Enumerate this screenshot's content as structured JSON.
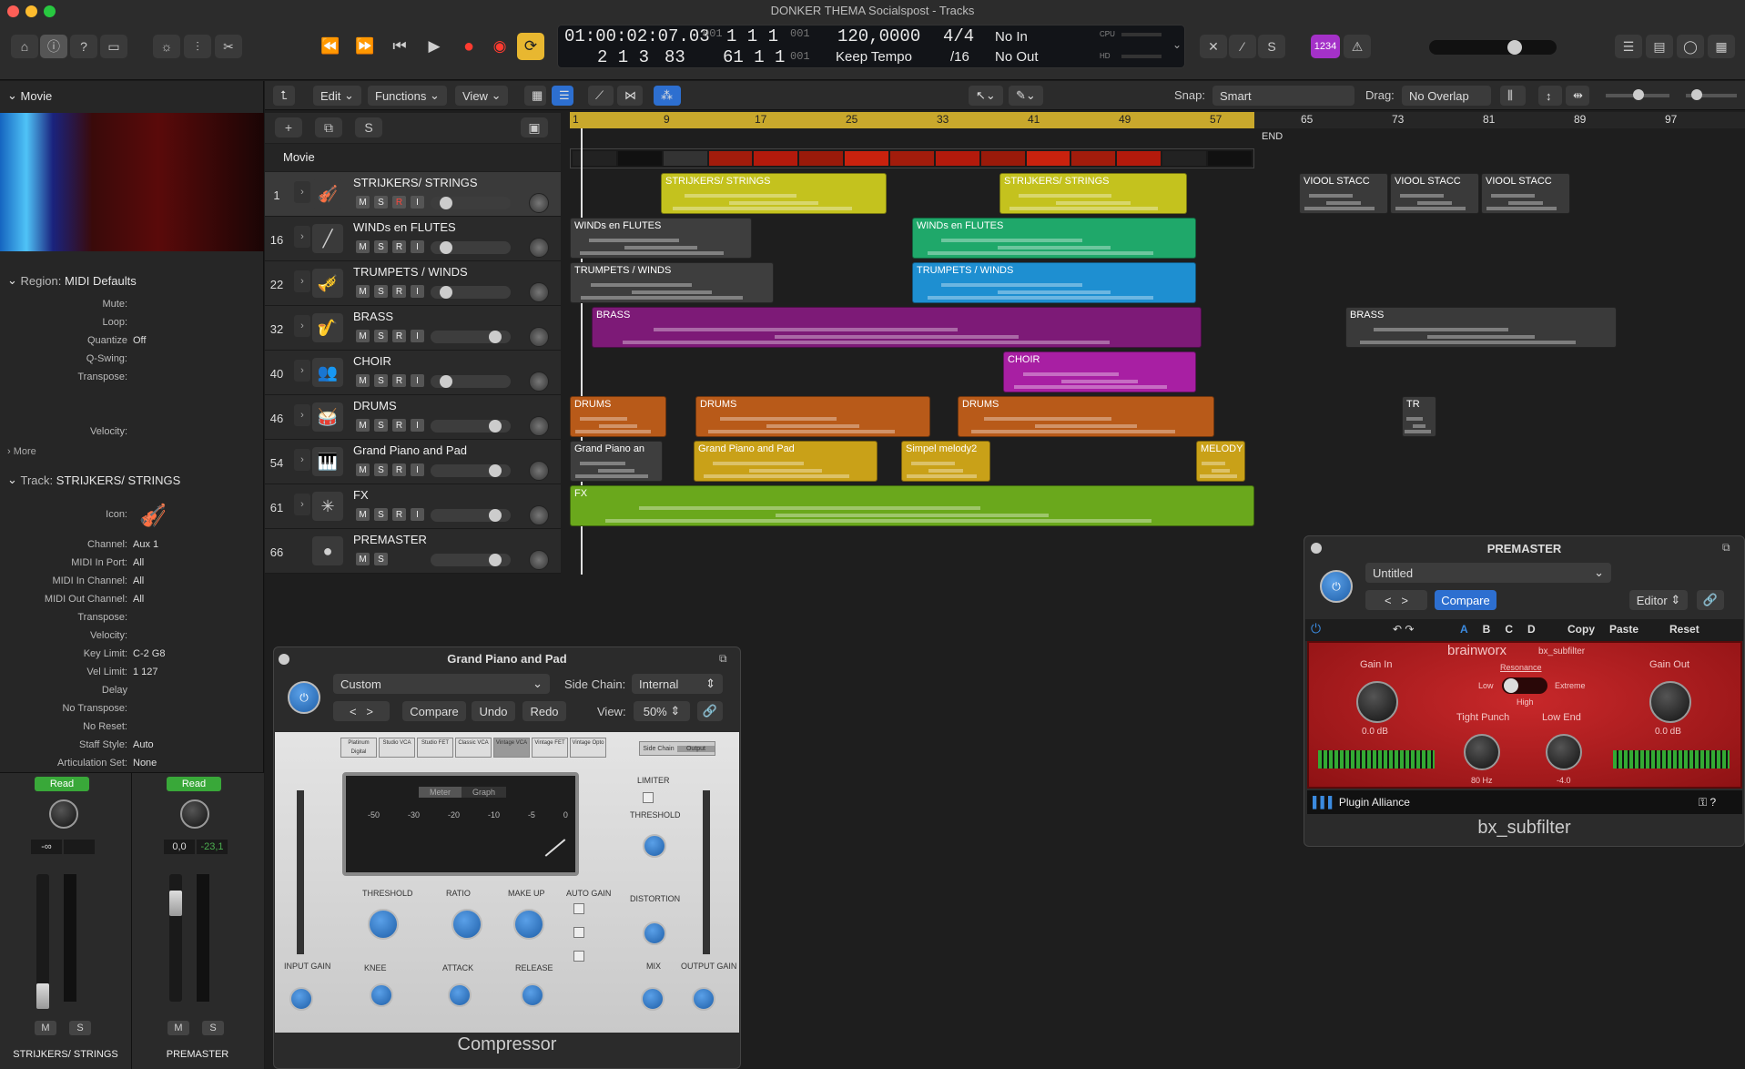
{
  "window": {
    "title": "DONKER THEMA Socialspost - Tracks"
  },
  "lcd": {
    "time": "01:00:02:07.03",
    "bars_top": "1  1  1",
    "bars_top_sub": "001",
    "bars_top_sub2": "001",
    "tempo": "120,0000",
    "signature": "4/4",
    "midi_in": "No In",
    "bars_bottom": "2  1  3",
    "bars_bottom_sub": "83",
    "pos2": "61  1  1",
    "pos2_sub": "001",
    "tempo_mode": "Keep Tempo",
    "division": "/16",
    "midi_out": "No Out",
    "cpu": "CPU",
    "hd": "HD"
  },
  "toolbar": {
    "count_in": "1234"
  },
  "tracks_menu": {
    "edit": "Edit",
    "functions": "Functions",
    "view": "View",
    "snap_label": "Snap:",
    "snap_value": "Smart",
    "drag_label": "Drag:",
    "drag_value": "No Overlap"
  },
  "inspector": {
    "movie_header": "Movie",
    "region_prefix": "Region:",
    "region_name": "MIDI Defaults",
    "region_rows": [
      {
        "k": "Mute:",
        "v": ""
      },
      {
        "k": "Loop:",
        "v": ""
      },
      {
        "k": "Quantize",
        "v": "Off"
      },
      {
        "k": "Q-Swing:",
        "v": ""
      },
      {
        "k": "Transpose:",
        "v": ""
      },
      {
        "k": "Velocity:",
        "v": ""
      }
    ],
    "more": "More",
    "track_prefix": "Track:",
    "track_name": "STRIJKERS/ STRINGS",
    "track_rows": [
      {
        "k": "Icon:",
        "v": ""
      },
      {
        "k": "Channel:",
        "v": "Aux 1"
      },
      {
        "k": "MIDI In Port:",
        "v": "All"
      },
      {
        "k": "MIDI In Channel:",
        "v": "All"
      },
      {
        "k": "MIDI Out Channel:",
        "v": "All"
      },
      {
        "k": "Transpose:",
        "v": ""
      },
      {
        "k": "Velocity:",
        "v": ""
      },
      {
        "k": "Key Limit:",
        "v": "C-2  G8"
      },
      {
        "k": "Vel Limit:",
        "v": "1  127"
      },
      {
        "k": "Delay",
        "v": ""
      },
      {
        "k": "No Transpose:",
        "v": ""
      },
      {
        "k": "No Reset:",
        "v": ""
      },
      {
        "k": "Staff Style:",
        "v": "Auto"
      },
      {
        "k": "Articulation Set:",
        "v": "None"
      }
    ],
    "strip1": {
      "read": "Read",
      "vol": "-∞",
      "name": "STRIJKERS/ STRINGS",
      "m": "M",
      "s": "S"
    },
    "strip2": {
      "read": "Read",
      "vol": "0,0",
      "peak": "-23,1",
      "name": "PREMASTER",
      "m": "M",
      "s": "S"
    }
  },
  "movie_track": "Movie",
  "tracks": [
    {
      "num": "1",
      "name": "STRIJKERS/ STRINGS",
      "icon": "violin-icon",
      "r_red": true
    },
    {
      "num": "16",
      "name": "WINDs en FLUTES",
      "icon": "flute-icon"
    },
    {
      "num": "22",
      "name": "TRUMPETS / WINDS",
      "icon": "trumpet-icon"
    },
    {
      "num": "32",
      "name": "BRASS",
      "icon": "horn-icon"
    },
    {
      "num": "40",
      "name": "CHOIR",
      "icon": "choir-icon"
    },
    {
      "num": "46",
      "name": "DRUMS",
      "icon": "drum-icon"
    },
    {
      "num": "54",
      "name": "Grand Piano and Pad",
      "icon": "piano-icon"
    },
    {
      "num": "61",
      "name": "FX",
      "icon": "fx-icon"
    },
    {
      "num": "66",
      "name": "PREMASTER",
      "icon": "master-icon"
    }
  ],
  "ruler": [
    "1",
    "9",
    "17",
    "25",
    "33",
    "41",
    "49",
    "57",
    "65",
    "73",
    "81",
    "89",
    "97"
  ],
  "end_label": "END",
  "regions": [
    {
      "track": 0,
      "label": "STRIJKERS/ STRINGS"
    },
    {
      "track": 0,
      "label": "STRIJKERS/ STRINGS"
    },
    {
      "track": 0,
      "label": "VIOOL STACC"
    },
    {
      "track": 0,
      "label": "VIOOL STACC"
    },
    {
      "track": 0,
      "label": "VIOOL STACC"
    },
    {
      "track": 1,
      "label": "WINDs en FLUTES"
    },
    {
      "track": 1,
      "label": "WINDs en FLUTES"
    },
    {
      "track": 2,
      "label": "TRUMPETS / WINDS"
    },
    {
      "track": 2,
      "label": "TRUMPETS / WINDS"
    },
    {
      "track": 3,
      "label": "BRASS"
    },
    {
      "track": 3,
      "label": "BRASS"
    },
    {
      "track": 4,
      "label": "CHOIR"
    },
    {
      "track": 5,
      "label": "DRUMS"
    },
    {
      "track": 5,
      "label": "DRUMS"
    },
    {
      "track": 5,
      "label": "DRUMS"
    },
    {
      "track": 5,
      "label": "TR"
    },
    {
      "track": 6,
      "label": "Grand Piano an"
    },
    {
      "track": 6,
      "label": "Grand Piano and Pad"
    },
    {
      "track": 6,
      "label": "Simpel melody2"
    },
    {
      "track": 6,
      "label": "MELODY"
    },
    {
      "track": 7,
      "label": "FX"
    }
  ],
  "compressor": {
    "title": "Grand Piano and Pad",
    "preset": "Custom",
    "sidechain_label": "Side Chain:",
    "sidechain": "Internal",
    "compare": "Compare",
    "undo": "Undo",
    "redo": "Redo",
    "view_label": "View:",
    "view": "50%",
    "models": [
      "Platinum Digital",
      "Studio VCA",
      "Studio FET",
      "Classic VCA",
      "Vintage VCA",
      "Vintage FET",
      "Vintage Opto"
    ],
    "meter": "Meter",
    "graph": "Graph",
    "scale": [
      "-50",
      "-30",
      "-20",
      "-10",
      "-5",
      "0"
    ],
    "knobs": [
      "THRESHOLD",
      "RATIO",
      "MAKE UP",
      "AUTO GAIN",
      "KNEE",
      "ATTACK",
      "RELEASE"
    ],
    "limiter": "LIMITER",
    "threshold": "THRESHOLD",
    "distortion": "DISTORTION",
    "mix": "MIX",
    "input_gain": "INPUT GAIN",
    "output_gain": "OUTPUT GAIN",
    "sidechain_btn": "Side Chain",
    "output_btn": "Output",
    "name": "Compressor"
  },
  "premaster_plugin": {
    "title": "PREMASTER",
    "preset": "Untitled",
    "compare": "Compare",
    "editor": "Editor",
    "abcd": [
      "A",
      "B",
      "C",
      "D"
    ],
    "copy": "Copy",
    "paste": "Paste",
    "reset": "Reset",
    "brand": "brainworx",
    "product_small": "bx_subfilter",
    "gain_in": "Gain In",
    "gain_in_val": "0.0 dB",
    "resonance": "Resonance",
    "low": "Low",
    "extreme": "Extreme",
    "high": "High",
    "tight_punch": "Tight Punch",
    "tight_val": "80 Hz",
    "low_end": "Low End",
    "low_end_val": "-4.0",
    "gain_out": "Gain Out",
    "gain_out_val": "0.0 dB",
    "alliance": "Plugin Alliance",
    "name": "bx_subfilter"
  }
}
